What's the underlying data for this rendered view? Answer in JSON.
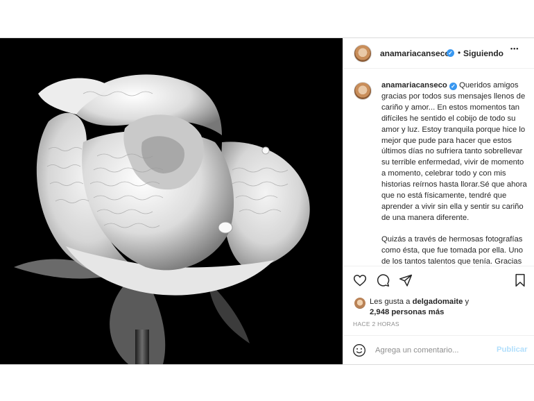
{
  "post": {
    "header": {
      "username": "anamariacanseco",
      "separator": "•",
      "follow_status": "Siguiendo",
      "more_label": "•••",
      "verified_mark": "✓"
    },
    "caption": {
      "username": "anamariacanseco",
      "paragraph_1": "Queridos amigos gracias por todos sus mensajes llenos de cariño y amor... En estos momentos tan difíciles he sentido el cobijo de todo su amor y luz. Estoy tranquila porque hice lo mejor que pude para hacer que estos últimos días no sufriera tanto sobrellevar su terrible enfermedad, vivir de momento a momento, celebrar todo y con mis historias reírnos hasta llorar.Sé que ahora que no está físicamente, tendré que aprender a vivir sin ella y sentir su cariño de una manera diferente.",
      "paragraph_2": "Quizás a través de hermosas fotografías como ésta, que fue tomada por ella. Uno de los tantos talentos que tenía. Gracias por sus oraciones y su cariño."
    },
    "actions": {
      "icons": [
        "heart-icon",
        "comment-icon",
        "share-icon",
        "bookmark-icon"
      ]
    },
    "likes": {
      "prefix": "Les gusta a",
      "liker": "delgadomaite",
      "conjunction": "y",
      "others": "2,948 personas más"
    },
    "time_ago": "HACE 2 HORAS",
    "comment": {
      "placeholder": "Agrega un comentario...",
      "publish_label": "Publicar"
    },
    "colors": {
      "verified": "#3897f0",
      "publish_disabled": "#b2dffc",
      "muted_text": "#8e8e8e",
      "photo_background": "#000000"
    }
  }
}
